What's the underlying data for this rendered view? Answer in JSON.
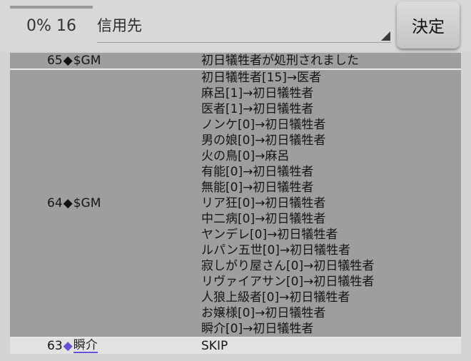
{
  "topbar": {
    "progress_percent": 0,
    "counter_text": "0% 16",
    "target_select_value": "信用先",
    "decide_label": "決定"
  },
  "log": [
    {
      "num": "65",
      "diamond": "◆",
      "name": "$GM",
      "lines": [
        "初日犠牲者が処刑されました"
      ]
    },
    {
      "num": "64",
      "diamond": "◆",
      "name": "$GM",
      "lines": [
        "初日犠牲者[15]→医者",
        "麻呂[1]→初日犠牲者",
        "医者[1]→初日犠牲者",
        "ノンケ[0]→初日犠牲者",
        "男の娘[0]→初日犠牲者",
        "火の鳥[0]→麻呂",
        "有能[0]→初日犠牲者",
        "無能[0]→初日犠牲者",
        "リア狂[0]→初日犠牲者",
        "中二病[0]→初日犠牲者",
        "ヤンデレ[0]→初日犠牲者",
        "ルパン五世[0]→初日犠牲者",
        "寂しがり屋さん[0]→初日犠牲者",
        "リヴァイアサン[0]→初日犠牲者",
        "人狼上級者[0]→初日犠牲者",
        "お嬢様[0]→初日犠牲者",
        "瞬介[0]→初日犠牲者"
      ]
    },
    {
      "num": "63",
      "diamond": "◆",
      "name": "瞬介",
      "lines": [
        "SKIP"
      ]
    }
  ]
}
